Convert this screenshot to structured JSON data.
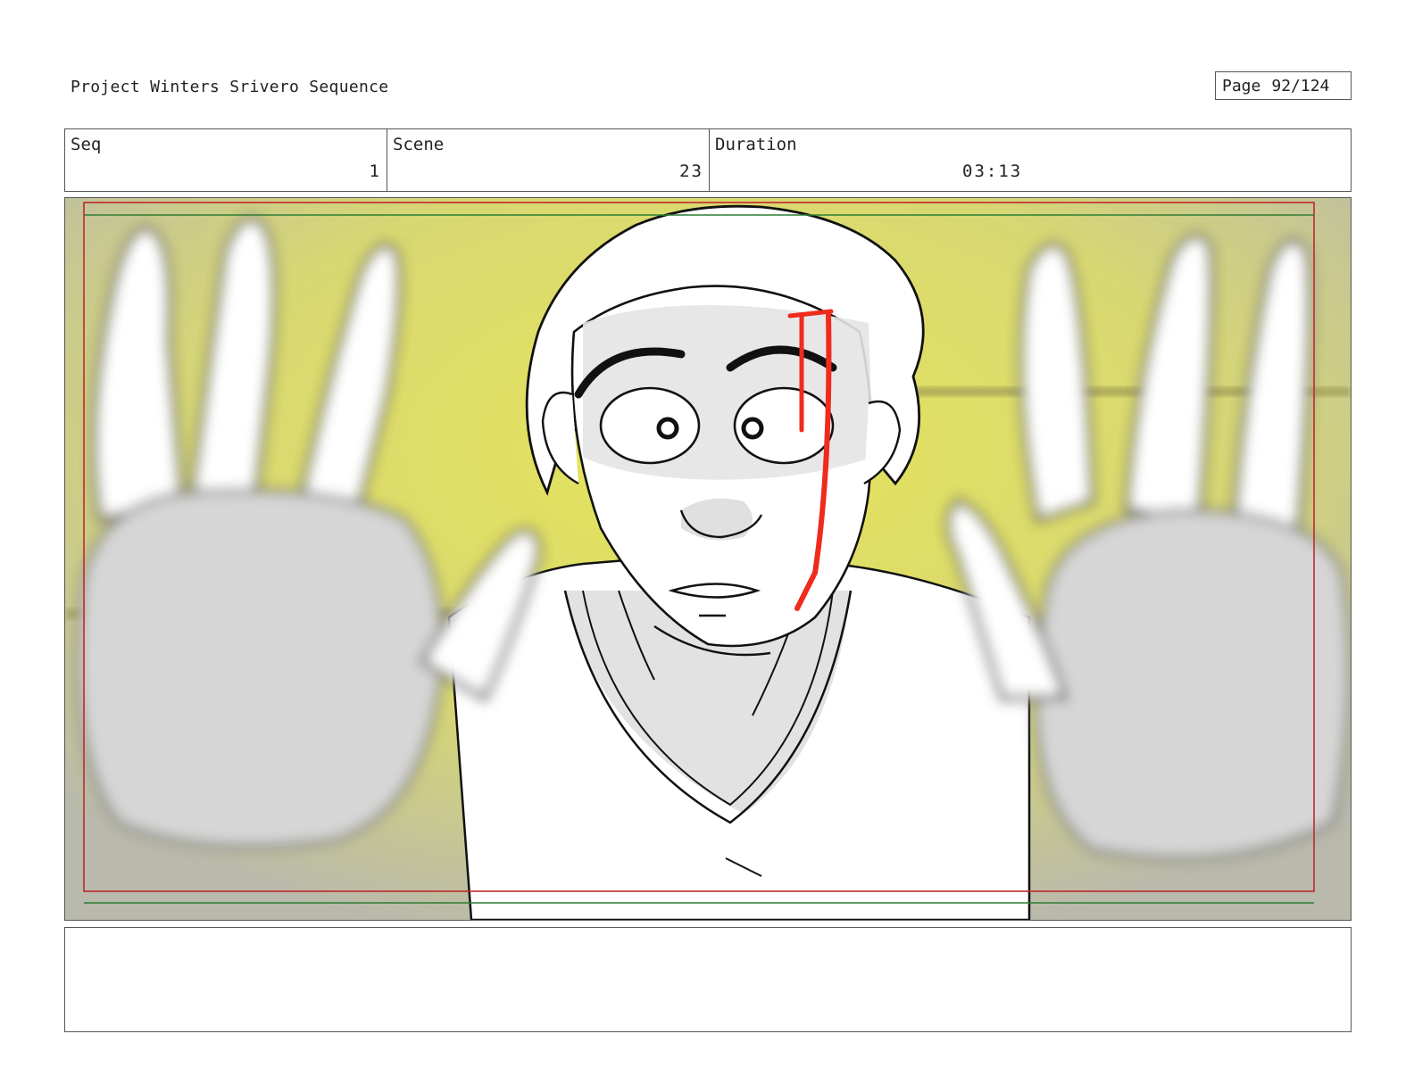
{
  "header": {
    "project_title": "Project Winters Srivero Sequence",
    "page_label": "Page",
    "page_value": "92/124"
  },
  "info": {
    "seq_label": "Seq",
    "seq_value": "1",
    "scene_label": "Scene",
    "scene_value": "23",
    "duration_label": "Duration",
    "duration_value": "03:13"
  },
  "panel": {
    "background_color": "#dcdc6a",
    "safe_frame_outer_color": "#c0282c",
    "safe_frame_inner_color": "#2e7d32",
    "accent_blood_color": "#ef2b1c"
  },
  "notes": {
    "text": ""
  }
}
